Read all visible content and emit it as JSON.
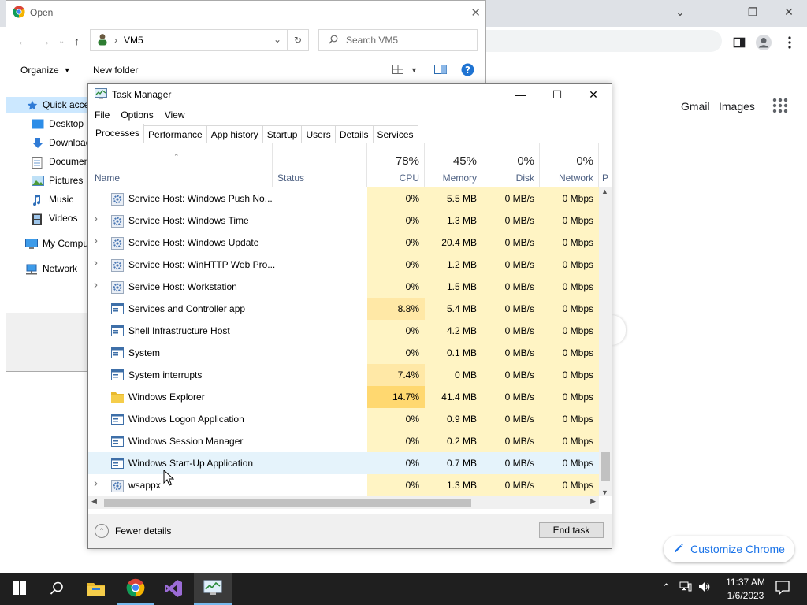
{
  "chrome": {
    "gmail": "Gmail",
    "images": "Images",
    "customize": "Customize Chrome",
    "accent": "#1a73e8"
  },
  "open_dialog": {
    "title": "Open",
    "address": "VM5",
    "search_placeholder": "Search VM5",
    "organize": "Organize",
    "new_folder": "New folder",
    "sidebar": [
      {
        "label": "Quick access",
        "icon": "star-icon"
      },
      {
        "label": "Desktop",
        "icon": "desktop-icon"
      },
      {
        "label": "Downloads",
        "icon": "download-icon"
      },
      {
        "label": "Documents",
        "icon": "documents-icon"
      },
      {
        "label": "Pictures",
        "icon": "pictures-icon"
      },
      {
        "label": "Music",
        "icon": "music-icon"
      },
      {
        "label": "Videos",
        "icon": "videos-icon"
      },
      {
        "label": "My Computer",
        "icon": "computer-icon"
      },
      {
        "label": "Network",
        "icon": "network-icon"
      }
    ]
  },
  "task_manager": {
    "title": "Task Manager",
    "menu": [
      "File",
      "Options",
      "View"
    ],
    "tabs": [
      "Processes",
      "Performance",
      "App history",
      "Startup",
      "Users",
      "Details",
      "Services"
    ],
    "columns": {
      "name": "Name",
      "status": "Status",
      "cpu": {
        "pct": "78%",
        "label": "CPU"
      },
      "memory": {
        "pct": "45%",
        "label": "Memory"
      },
      "disk": {
        "pct": "0%",
        "label": "Disk"
      },
      "network": {
        "pct": "0%",
        "label": "Network"
      },
      "power": "P"
    },
    "rows": [
      {
        "name": "Service Host: Windows Push No...",
        "expandable": false,
        "icon": "gear-icon",
        "cpu": "0%",
        "memory": "5.5 MB",
        "disk": "0 MB/s",
        "network": "0 Mbps",
        "cpu_heat": "#fff4c4"
      },
      {
        "name": "Service Host: Windows Time",
        "expandable": true,
        "icon": "gear-icon",
        "cpu": "0%",
        "memory": "1.3 MB",
        "disk": "0 MB/s",
        "network": "0 Mbps",
        "cpu_heat": "#fff4c4"
      },
      {
        "name": "Service Host: Windows Update",
        "expandable": true,
        "icon": "gear-icon",
        "cpu": "0%",
        "memory": "20.4 MB",
        "disk": "0 MB/s",
        "network": "0 Mbps",
        "cpu_heat": "#fff4c4"
      },
      {
        "name": "Service Host: WinHTTP Web Pro...",
        "expandable": true,
        "icon": "gear-icon",
        "cpu": "0%",
        "memory": "1.2 MB",
        "disk": "0 MB/s",
        "network": "0 Mbps",
        "cpu_heat": "#fff4c4"
      },
      {
        "name": "Service Host: Workstation",
        "expandable": true,
        "icon": "gear-icon",
        "cpu": "0%",
        "memory": "1.5 MB",
        "disk": "0 MB/s",
        "network": "0 Mbps",
        "cpu_heat": "#fff4c4"
      },
      {
        "name": "Services and Controller app",
        "expandable": false,
        "icon": "window-icon",
        "cpu": "8.8%",
        "memory": "5.4 MB",
        "disk": "0 MB/s",
        "network": "0 Mbps",
        "cpu_heat": "#ffe8a6"
      },
      {
        "name": "Shell Infrastructure Host",
        "expandable": false,
        "icon": "window-icon",
        "cpu": "0%",
        "memory": "4.2 MB",
        "disk": "0 MB/s",
        "network": "0 Mbps",
        "cpu_heat": "#fff4c4"
      },
      {
        "name": "System",
        "expandable": false,
        "icon": "window-icon",
        "cpu": "0%",
        "memory": "0.1 MB",
        "disk": "0 MB/s",
        "network": "0 Mbps",
        "cpu_heat": "#fff4c4"
      },
      {
        "name": "System interrupts",
        "expandable": false,
        "icon": "window-icon",
        "cpu": "7.4%",
        "memory": "0 MB",
        "disk": "0 MB/s",
        "network": "0 Mbps",
        "cpu_heat": "#ffe8a6"
      },
      {
        "name": "Windows Explorer",
        "expandable": false,
        "icon": "folder-icon",
        "cpu": "14.7%",
        "memory": "41.4 MB",
        "disk": "0 MB/s",
        "network": "0 Mbps",
        "cpu_heat": "#ffd870"
      },
      {
        "name": "Windows Logon Application",
        "expandable": false,
        "icon": "window-icon",
        "cpu": "0%",
        "memory": "0.9 MB",
        "disk": "0 MB/s",
        "network": "0 Mbps",
        "cpu_heat": "#fff4c4"
      },
      {
        "name": "Windows Session Manager",
        "expandable": false,
        "icon": "window-icon",
        "cpu": "0%",
        "memory": "0.2 MB",
        "disk": "0 MB/s",
        "network": "0 Mbps",
        "cpu_heat": "#fff4c4"
      },
      {
        "name": "Windows Start-Up Application",
        "expandable": false,
        "icon": "window-icon",
        "cpu": "0%",
        "memory": "0.7 MB",
        "disk": "0 MB/s",
        "network": "0 Mbps",
        "cpu_heat": "#fff4c4",
        "selected": true
      },
      {
        "name": "wsappx",
        "expandable": true,
        "icon": "gear-icon",
        "cpu": "0%",
        "memory": "1.3 MB",
        "disk": "0 MB/s",
        "network": "0 Mbps",
        "cpu_heat": "#fff4c4"
      }
    ],
    "footer": {
      "fewer_details": "Fewer details",
      "end_task": "End task"
    }
  },
  "taskbar": {
    "time": "11:37 AM",
    "date": "1/6/2023"
  }
}
